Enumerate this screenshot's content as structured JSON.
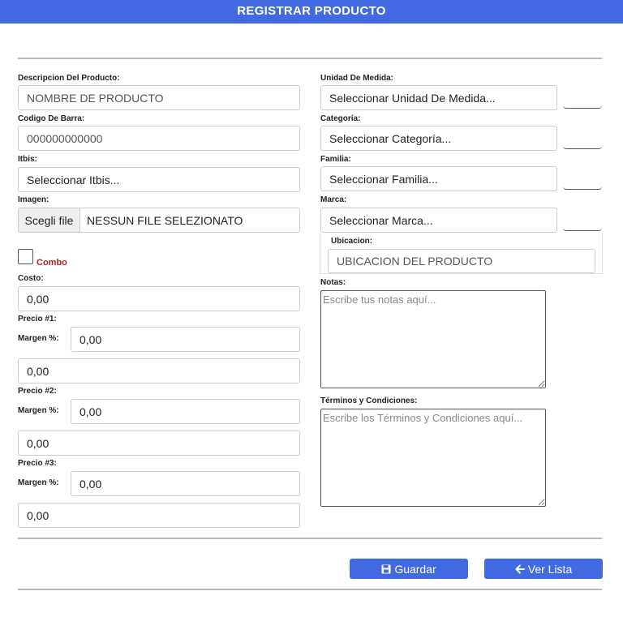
{
  "header": {
    "title": "REGISTRAR PRODUCTO"
  },
  "left": {
    "descripcion": {
      "label": "Descripcion Del Producto:",
      "placeholder": "NOMBRE DE PRODUCTO"
    },
    "codigo": {
      "label": "Codigo De Barra:",
      "value": "000000000000"
    },
    "itbis": {
      "label": "Itbis:",
      "selected": "Seleccionar Itbis..."
    },
    "imagen": {
      "label": "Imagen:",
      "button": "Scegli file",
      "filename": "NESSUN FILE SELEZIONATO"
    },
    "combo": {
      "label": "Combo"
    },
    "costo": {
      "label": "Costo:",
      "value": "0,00"
    },
    "precio1": {
      "label": "Precio #1:",
      "margen_label": "Margen %:",
      "margen_value": "0,00",
      "value": "0,00"
    },
    "precio2": {
      "label": "Precio #2:",
      "margen_label": "Margen %:",
      "margen_value": "0,00",
      "value": "0,00"
    },
    "precio3": {
      "label": "Precio #3:",
      "margen_label": "Margen %:",
      "margen_value": "0,00",
      "value": "0,00"
    }
  },
  "right": {
    "unidad": {
      "label": "Unidad De Medida:",
      "selected": "Seleccionar Unidad De Medida..."
    },
    "categoria": {
      "label": "Categoría:",
      "selected": "Seleccionar Categoría..."
    },
    "familia": {
      "label": "Familia:",
      "selected": "Seleccionar Familia..."
    },
    "marca": {
      "label": "Marca:",
      "selected": "Seleccionar Marca..."
    },
    "ubicacion": {
      "label": "Ubicacion:",
      "placeholder": "UBICACION DEL PRODUCTO"
    },
    "notas": {
      "label": "Notas:",
      "placeholder": "Escribe tus notas aquí..."
    },
    "terminos": {
      "label": "Términos y Condiciones:",
      "placeholder": "Escribe los Términos y Condiciones aquí..."
    }
  },
  "actions": {
    "save_label": "Guardar",
    "list_label": "Ver Lista"
  },
  "colors": {
    "header": "#4169e1",
    "button": "#4169e1",
    "combo_text": "#b22222"
  }
}
